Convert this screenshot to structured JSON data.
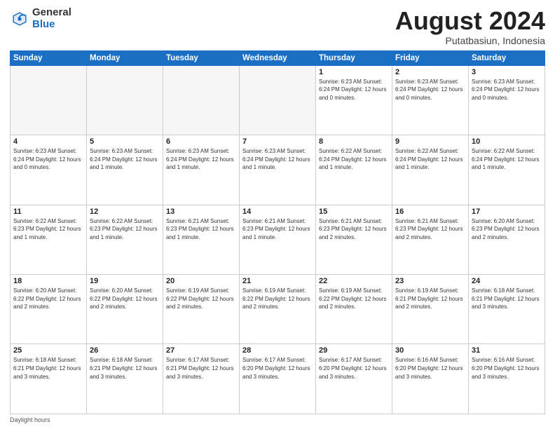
{
  "header": {
    "logo_general": "General",
    "logo_blue": "Blue",
    "title": "August 2024",
    "location": "Putatbasiun, Indonesia"
  },
  "days_of_week": [
    "Sunday",
    "Monday",
    "Tuesday",
    "Wednesday",
    "Thursday",
    "Friday",
    "Saturday"
  ],
  "weeks": [
    [
      {
        "day": "",
        "info": ""
      },
      {
        "day": "",
        "info": ""
      },
      {
        "day": "",
        "info": ""
      },
      {
        "day": "",
        "info": ""
      },
      {
        "day": "1",
        "info": "Sunrise: 6:23 AM\nSunset: 6:24 PM\nDaylight: 12 hours\nand 0 minutes."
      },
      {
        "day": "2",
        "info": "Sunrise: 6:23 AM\nSunset: 6:24 PM\nDaylight: 12 hours\nand 0 minutes."
      },
      {
        "day": "3",
        "info": "Sunrise: 6:23 AM\nSunset: 6:24 PM\nDaylight: 12 hours\nand 0 minutes."
      }
    ],
    [
      {
        "day": "4",
        "info": "Sunrise: 6:23 AM\nSunset: 6:24 PM\nDaylight: 12 hours\nand 0 minutes."
      },
      {
        "day": "5",
        "info": "Sunrise: 6:23 AM\nSunset: 6:24 PM\nDaylight: 12 hours\nand 1 minute."
      },
      {
        "day": "6",
        "info": "Sunrise: 6:23 AM\nSunset: 6:24 PM\nDaylight: 12 hours\nand 1 minute."
      },
      {
        "day": "7",
        "info": "Sunrise: 6:23 AM\nSunset: 6:24 PM\nDaylight: 12 hours\nand 1 minute."
      },
      {
        "day": "8",
        "info": "Sunrise: 6:22 AM\nSunset: 6:24 PM\nDaylight: 12 hours\nand 1 minute."
      },
      {
        "day": "9",
        "info": "Sunrise: 6:22 AM\nSunset: 6:24 PM\nDaylight: 12 hours\nand 1 minute."
      },
      {
        "day": "10",
        "info": "Sunrise: 6:22 AM\nSunset: 6:24 PM\nDaylight: 12 hours\nand 1 minute."
      }
    ],
    [
      {
        "day": "11",
        "info": "Sunrise: 6:22 AM\nSunset: 6:23 PM\nDaylight: 12 hours\nand 1 minute."
      },
      {
        "day": "12",
        "info": "Sunrise: 6:22 AM\nSunset: 6:23 PM\nDaylight: 12 hours\nand 1 minute."
      },
      {
        "day": "13",
        "info": "Sunrise: 6:21 AM\nSunset: 6:23 PM\nDaylight: 12 hours\nand 1 minute."
      },
      {
        "day": "14",
        "info": "Sunrise: 6:21 AM\nSunset: 6:23 PM\nDaylight: 12 hours\nand 1 minute."
      },
      {
        "day": "15",
        "info": "Sunrise: 6:21 AM\nSunset: 6:23 PM\nDaylight: 12 hours\nand 2 minutes."
      },
      {
        "day": "16",
        "info": "Sunrise: 6:21 AM\nSunset: 6:23 PM\nDaylight: 12 hours\nand 2 minutes."
      },
      {
        "day": "17",
        "info": "Sunrise: 6:20 AM\nSunset: 6:23 PM\nDaylight: 12 hours\nand 2 minutes."
      }
    ],
    [
      {
        "day": "18",
        "info": "Sunrise: 6:20 AM\nSunset: 6:22 PM\nDaylight: 12 hours\nand 2 minutes."
      },
      {
        "day": "19",
        "info": "Sunrise: 6:20 AM\nSunset: 6:22 PM\nDaylight: 12 hours\nand 2 minutes."
      },
      {
        "day": "20",
        "info": "Sunrise: 6:19 AM\nSunset: 6:22 PM\nDaylight: 12 hours\nand 2 minutes."
      },
      {
        "day": "21",
        "info": "Sunrise: 6:19 AM\nSunset: 6:22 PM\nDaylight: 12 hours\nand 2 minutes."
      },
      {
        "day": "22",
        "info": "Sunrise: 6:19 AM\nSunset: 6:22 PM\nDaylight: 12 hours\nand 2 minutes."
      },
      {
        "day": "23",
        "info": "Sunrise: 6:19 AM\nSunset: 6:21 PM\nDaylight: 12 hours\nand 2 minutes."
      },
      {
        "day": "24",
        "info": "Sunrise: 6:18 AM\nSunset: 6:21 PM\nDaylight: 12 hours\nand 3 minutes."
      }
    ],
    [
      {
        "day": "25",
        "info": "Sunrise: 6:18 AM\nSunset: 6:21 PM\nDaylight: 12 hours\nand 3 minutes."
      },
      {
        "day": "26",
        "info": "Sunrise: 6:18 AM\nSunset: 6:21 PM\nDaylight: 12 hours\nand 3 minutes."
      },
      {
        "day": "27",
        "info": "Sunrise: 6:17 AM\nSunset: 6:21 PM\nDaylight: 12 hours\nand 3 minutes."
      },
      {
        "day": "28",
        "info": "Sunrise: 6:17 AM\nSunset: 6:20 PM\nDaylight: 12 hours\nand 3 minutes."
      },
      {
        "day": "29",
        "info": "Sunrise: 6:17 AM\nSunset: 6:20 PM\nDaylight: 12 hours\nand 3 minutes."
      },
      {
        "day": "30",
        "info": "Sunrise: 6:16 AM\nSunset: 6:20 PM\nDaylight: 12 hours\nand 3 minutes."
      },
      {
        "day": "31",
        "info": "Sunrise: 6:16 AM\nSunset: 6:20 PM\nDaylight: 12 hours\nand 3 minutes."
      }
    ]
  ],
  "footer": "Daylight hours"
}
